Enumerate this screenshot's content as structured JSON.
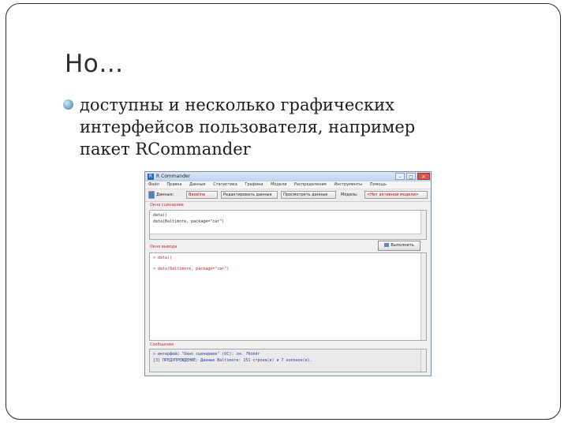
{
  "slide": {
    "title": "Но…",
    "bullet": "доступны и несколько графических интерфейсов пользователя, например пакет RCommander"
  },
  "rcmdr": {
    "window_title": "R Commander",
    "window_buttons": {
      "minimize": "–",
      "maximize": "□",
      "close": "✕"
    },
    "menu": [
      "Файл",
      "Правка",
      "Данные",
      "Статистика",
      "Графики",
      "Модели",
      "Распределения",
      "Инструменты",
      "Помощь"
    ],
    "toolbar": {
      "data_label": "Данные:",
      "dataset_button": "Baseline",
      "edit_button": "Редактировать данные",
      "view_button": "Просмотреть данные",
      "model_label": "Модель:",
      "model_value": "<Нет активной модели>"
    },
    "script_label": "Окно сценариев",
    "script_lines": [
      "data()",
      "data(Baltimore, package=\"car\")"
    ],
    "output_label": "Окно вывода",
    "run_button": "Выполнить",
    "output_lines": [
      "> data()",
      "> data(Baltimore, package=\"car\")"
    ],
    "messages_label": "Сообщения",
    "message_lines": [
      "> интерфейс \"Окно сценариев\" (ОС): см. ?Rcmdr",
      "[3] ПРЕДУПРЕЖДЕНИЕ: Данные Baltimore: 151 строка(и) и 7 колонок(и)."
    ],
    "icons": {
      "app": "r-logo-icon",
      "run": "run-icon"
    }
  }
}
